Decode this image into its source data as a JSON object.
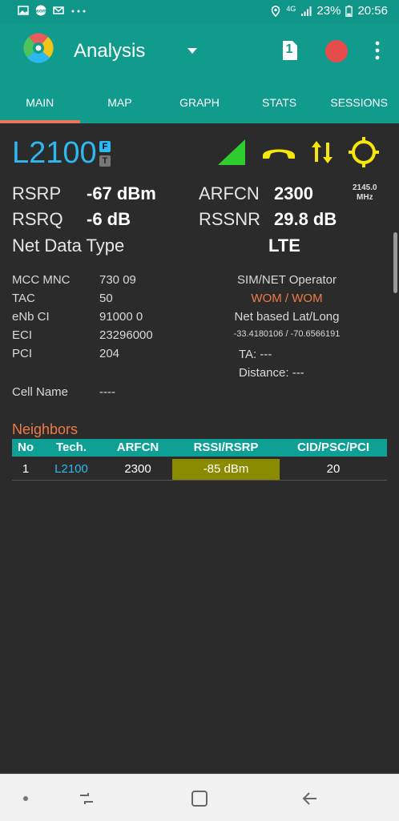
{
  "status_bar": {
    "battery": "23%",
    "time": "20:56",
    "network": "4G",
    "icons": [
      "image-icon",
      "wom-app-icon",
      "mail-icon",
      "more-notifications-icon",
      "location-icon",
      "signal-icon",
      "battery-icon"
    ]
  },
  "app_bar": {
    "title": "Analysis",
    "sim_slot": "1",
    "tabs": [
      {
        "label": "MAIN"
      },
      {
        "label": "MAP"
      },
      {
        "label": "GRAPH"
      },
      {
        "label": "STATS"
      },
      {
        "label": "SESSIONS"
      }
    ],
    "active_tab": "MAIN",
    "colors": {
      "primary": "#119b8d",
      "indicator": "#e8775a",
      "record": "#e74c4c"
    }
  },
  "serving": {
    "tech": "L2100",
    "badge_f": "F",
    "badge_t": "T",
    "icons": [
      "signal-strength-icon",
      "call-icon",
      "data-transfer-icon",
      "gps-icon"
    ],
    "rsrp_label": "RSRP",
    "rsrp_value": "-67 dBm",
    "rsrq_label": "RSRQ",
    "rsrq_value": "-6 dB",
    "arfcn_label": "ARFCN",
    "arfcn_value": "2300",
    "rssnr_label": "RSSNR",
    "rssnr_value": "29.8 dB",
    "freq_value": "2145.0",
    "freq_unit": "MHz",
    "net_data_type_label": "Net Data Type",
    "net_data_type_value": "LTE"
  },
  "cell_info": {
    "mcc_mnc_label": "MCC MNC",
    "mcc_mnc_value": "730 09",
    "tac_label": "TAC",
    "tac_value": "50",
    "enb_ci_label": "eNb CI",
    "enb_ci_value": "91000 0",
    "eci_label": "ECI",
    "eci_value": "23296000",
    "pci_label": "PCI",
    "pci_value": "204",
    "operator_label": "SIM/NET Operator",
    "operator_value": "WOM / WOM",
    "latlong_label": "Net based Lat/Long",
    "latlong_value": "-33.4180106 / -70.6566191",
    "ta_label": "TA: ---",
    "distance_label": "Distance: ---",
    "cell_name_label": "Cell Name",
    "cell_name_value": "----"
  },
  "neighbors": {
    "title": "Neighbors",
    "columns": [
      "No",
      "Tech.",
      "ARFCN",
      "RSSI/RSRP",
      "CID/PSC/PCI"
    ],
    "rows": [
      {
        "no": "1",
        "tech": "L2100",
        "arfcn": "2300",
        "rssi_rsrp": "-85 dBm",
        "cid": "20"
      }
    ]
  },
  "nav_bar": {
    "buttons": [
      "dot-icon",
      "recent-apps-icon",
      "home-icon",
      "back-icon"
    ]
  }
}
